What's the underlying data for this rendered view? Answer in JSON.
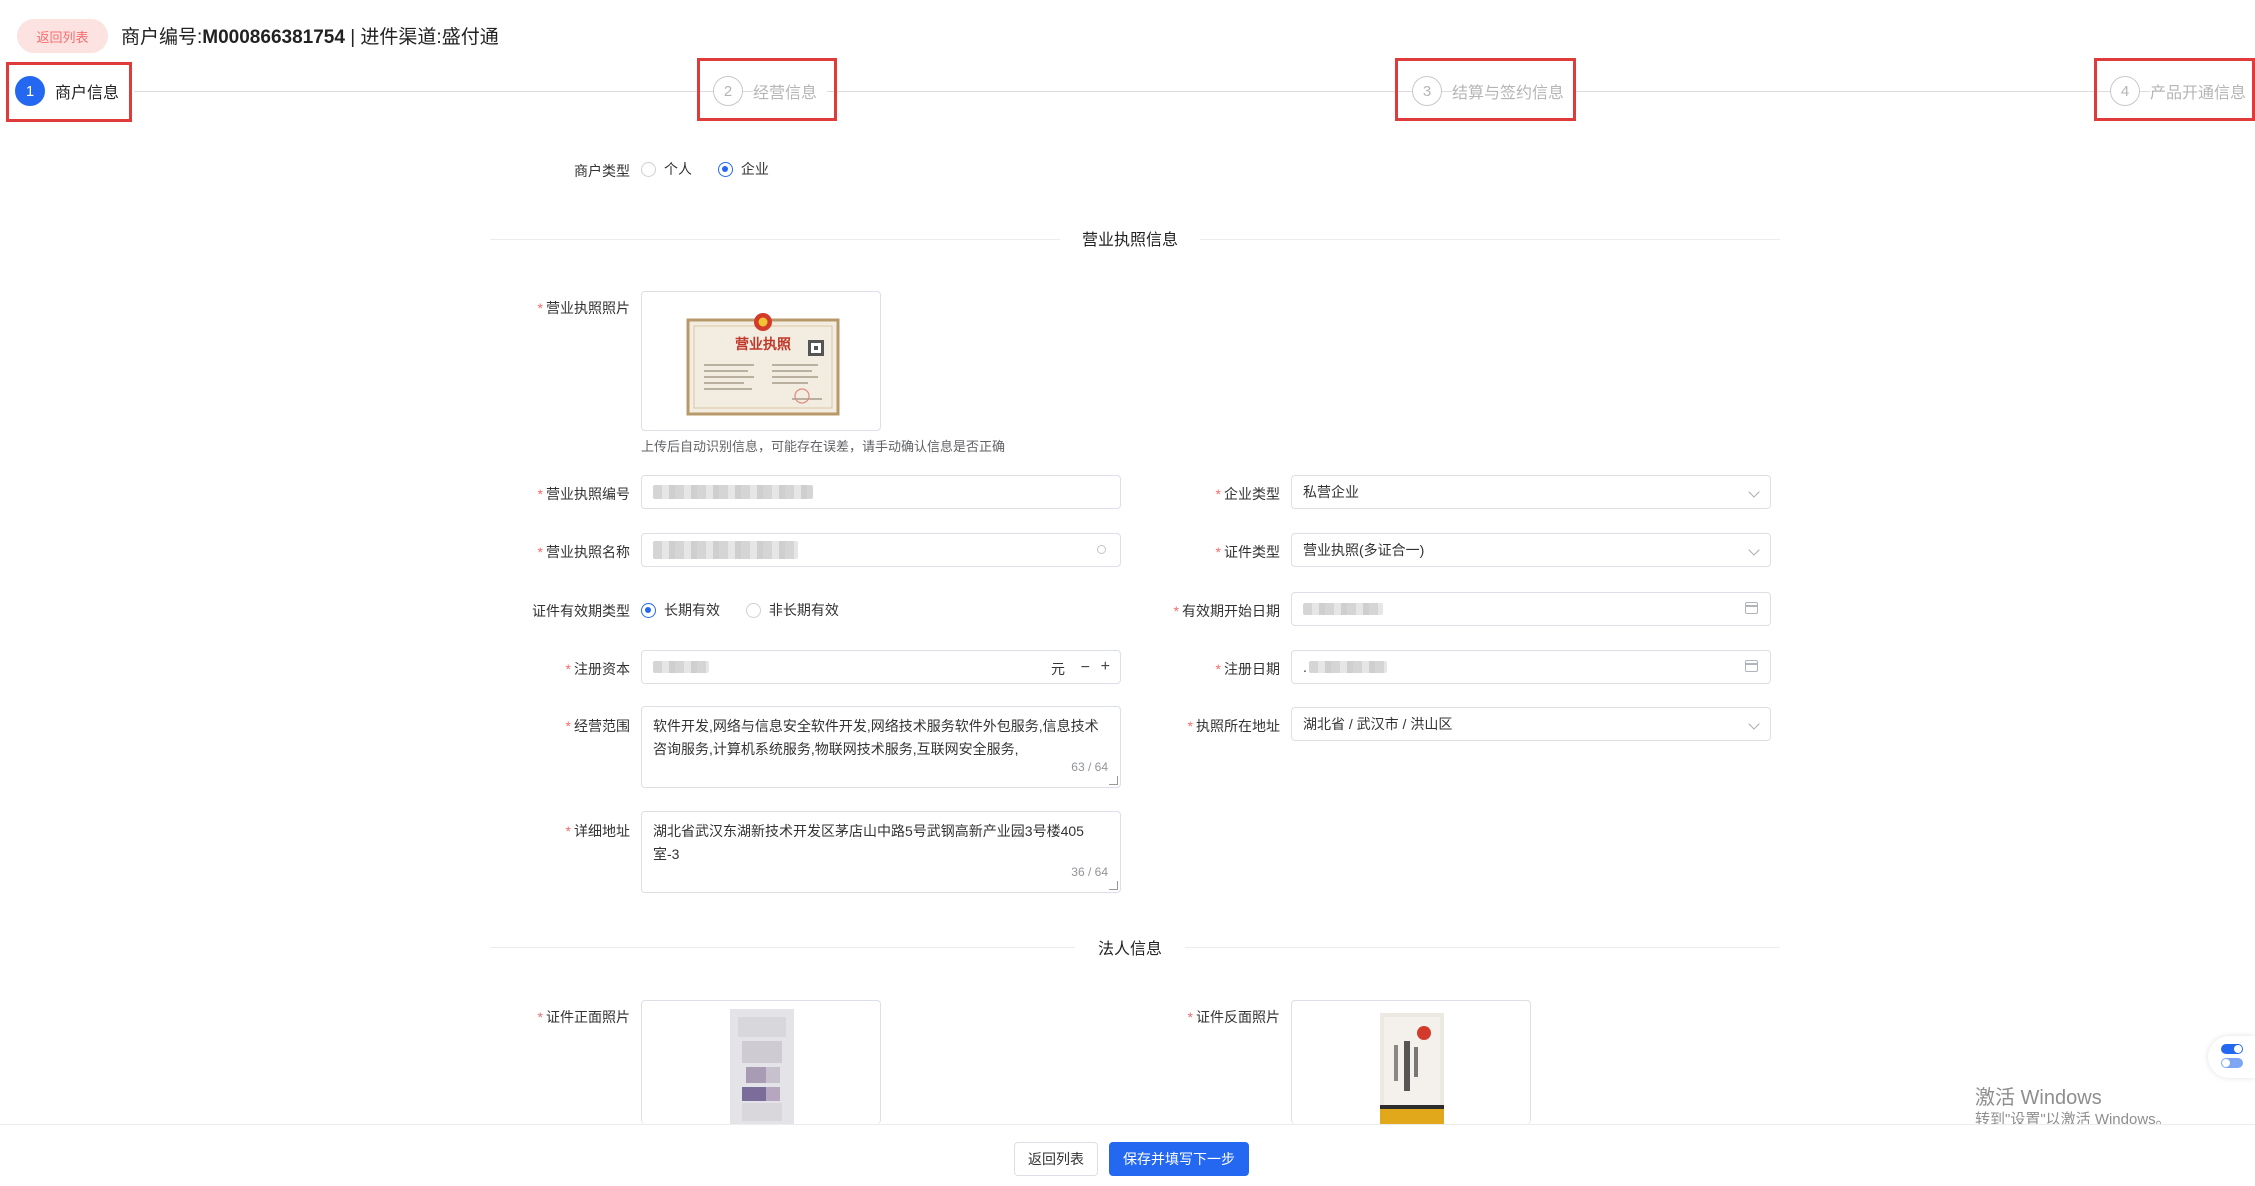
{
  "header": {
    "back_tag": "返回列表",
    "merchant_label": "商户编号:",
    "merchant_no": "M000866381754",
    "channel_text": " | 进件渠道:盛付通"
  },
  "steps": [
    {
      "num": "1",
      "label": "商户信息",
      "active": true
    },
    {
      "num": "2",
      "label": "经营信息",
      "active": false
    },
    {
      "num": "3",
      "label": "结算与签约信息",
      "active": false
    },
    {
      "num": "4",
      "label": "产品开通信息",
      "active": false
    }
  ],
  "merchant_type": {
    "label": "商户类型",
    "options": [
      "个人",
      "企业"
    ],
    "selected": "企业"
  },
  "license_section": {
    "title": "营业执照信息",
    "photo_label": "营业执照照片",
    "license_title": "营业执照",
    "upload_hint": "上传后自动识别信息，可能存在误差，请手动确认信息是否正确",
    "license_no_label": "营业执照编号",
    "license_name_label": "营业执照名称",
    "validity_type_label": "证件有效期类型",
    "validity_options": [
      "长期有效",
      "非长期有效"
    ],
    "validity_selected": "长期有效",
    "capital_label": "注册资本",
    "capital_unit": "元",
    "scope_label": "经营范围",
    "scope_value": "软件开发,网络与信息安全软件开发,网络技术服务软件外包服务,信息技术咨询服务,计算机系统服务,物联网技术服务,互联网安全服务,",
    "scope_count": "63 / 64",
    "address_label": "详细地址",
    "address_value": "湖北省武汉东湖新技术开发区茅店山中路5号武钢高新产业园3号楼405室-3",
    "address_count": "36 / 64",
    "company_type_label": "企业类型",
    "company_type_value": "私营企业",
    "cert_type_label": "证件类型",
    "cert_type_value": "营业执照(多证合一)",
    "start_date_label": "有效期开始日期",
    "reg_date_label": "注册日期",
    "reg_date_prefix": ".",
    "license_location_label": "执照所在地址",
    "license_location_value": "湖北省 / 武汉市 / 洪山区"
  },
  "legal_section": {
    "title": "法人信息",
    "front_label": "证件正面照片",
    "back_label": "证件反面照片"
  },
  "footer": {
    "back_button": "返回列表",
    "save_button": "保存并填写下一步"
  },
  "watermark": {
    "line1": "激活 Windows",
    "line2": "转到\"设置\"以激活 Windows。"
  },
  "colors": {
    "primary": "#2468f2",
    "danger": "#f56c6c",
    "highlight": "#e03b3b"
  }
}
